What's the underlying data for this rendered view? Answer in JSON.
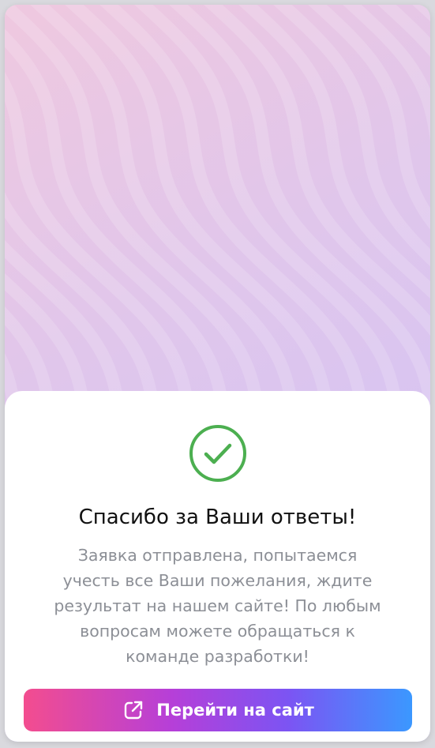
{
  "success": {
    "title": "Спасибо за Ваши ответы!",
    "message": "Заявка отправлена, попытаемся учесть все Ваши пожелания, ждите результат на нашем сайте! По любым вопросам можете обращаться к команде разработки!",
    "status_color": "#4caf50"
  },
  "cta": {
    "label": "Перейти на сайт",
    "icon": "external-link-icon",
    "gradient": [
      "#f34d8f",
      "#b63fd8",
      "#7c54f3",
      "#3b98ff"
    ]
  },
  "hero": {
    "pattern": "wave-pattern"
  }
}
